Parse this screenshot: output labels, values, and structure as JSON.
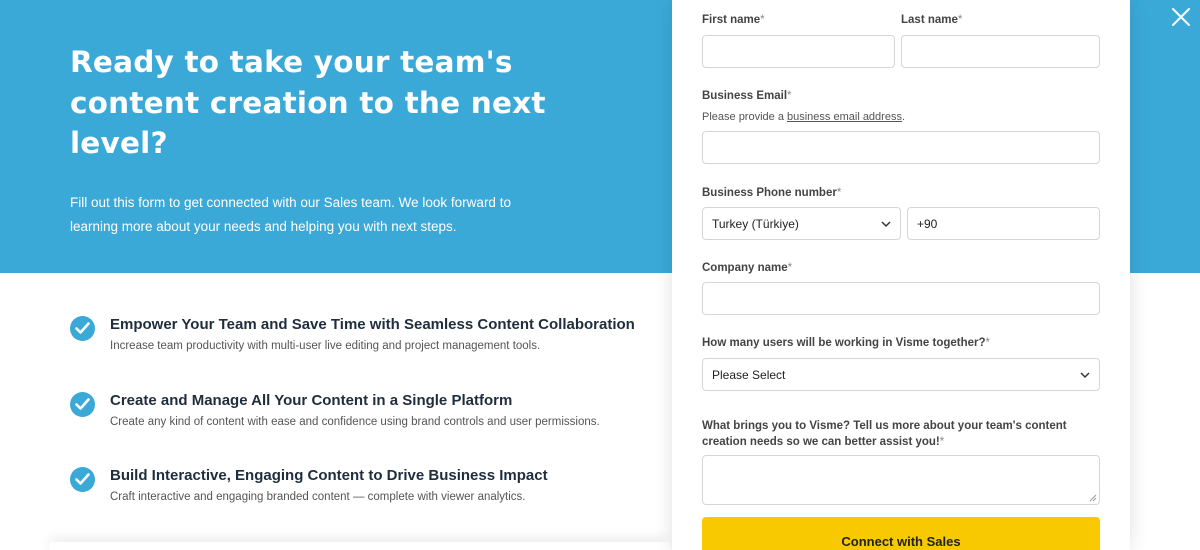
{
  "hero": {
    "title": "Ready to take your team's content creation to the next level?",
    "subtitle": "Fill out this form to get connected with our Sales team. We look forward to learning more about your needs and helping you with next steps.",
    "background": "#3ba9d8"
  },
  "features": [
    {
      "title": "Empower Your Team and Save Time with Seamless Content Collaboration",
      "desc": "Increase team productivity with multi-user live editing and project management tools.",
      "icon": "check-circle-icon"
    },
    {
      "title": "Create and Manage All Your Content in a Single Platform",
      "desc": "Create any kind of content with ease and confidence using brand controls and user permissions.",
      "icon": "check-circle-icon"
    },
    {
      "title": "Build Interactive, Engaging Content to Drive Business Impact",
      "desc": "Craft interactive and engaging branded content — complete with viewer analytics.",
      "icon": "check-circle-icon"
    }
  ],
  "form": {
    "first_name_label": "First name",
    "last_name_label": "Last name",
    "email_label": "Business Email",
    "email_hint_prefix": "Please provide a ",
    "email_hint_link": "business email address",
    "email_hint_suffix": ".",
    "phone_label": "Business Phone number",
    "country_value": "Turkey (Türkiye)",
    "phone_value": "+90",
    "company_label": "Company name",
    "users_label": "How many users will be working in Visme together?",
    "users_value": "Please Select",
    "brings_label": "What brings you to Visme? Tell us more about your team's content creation needs so we can better assist you!",
    "required_mark": "*",
    "submit_label": "Connect with Sales",
    "submit_color": "#f8c800"
  }
}
